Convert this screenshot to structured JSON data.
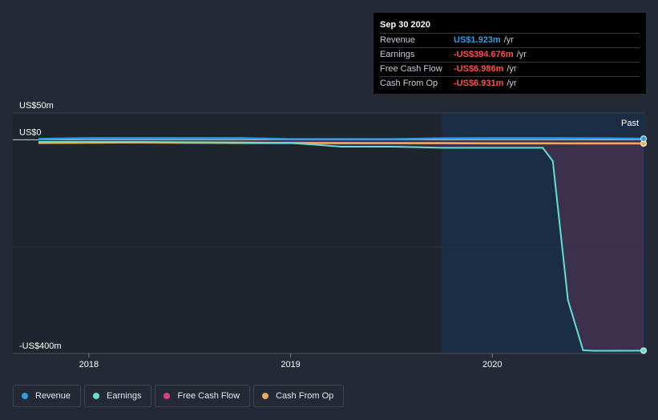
{
  "tooltip": {
    "date": "Sep 30 2020",
    "rows": [
      {
        "label": "Revenue",
        "value": "US$1.923m",
        "unit": "/yr",
        "color": "#2e9ee6"
      },
      {
        "label": "Earnings",
        "value": "-US$394.676m",
        "unit": "/yr",
        "color": "#ff4d4d"
      },
      {
        "label": "Free Cash Flow",
        "value": "-US$6.986m",
        "unit": "/yr",
        "color": "#ff4d4d"
      },
      {
        "label": "Cash From Op",
        "value": "-US$6.931m",
        "unit": "/yr",
        "color": "#ff4d4d"
      }
    ]
  },
  "legend": [
    {
      "label": "Revenue",
      "color": "#2e9ee6"
    },
    {
      "label": "Earnings",
      "color": "#5fe0d0"
    },
    {
      "label": "Free Cash Flow",
      "color": "#d6457a"
    },
    {
      "label": "Cash From Op",
      "color": "#f0aa5a"
    }
  ],
  "chart_data": {
    "type": "line",
    "y_tick_labels": [
      "US$50m",
      "US$0",
      "-US$400m"
    ],
    "y_ticks": [
      50,
      0,
      -400
    ],
    "ylim": [
      -400,
      50
    ],
    "xlim": [
      2017.75,
      2020.75
    ],
    "x_tick_labels": [
      "2018",
      "2019",
      "2020"
    ],
    "x_ticks": [
      2018,
      2019,
      2020
    ],
    "past_label": "Past",
    "past_region_start": 2019.75,
    "grid": "horizontal",
    "series": [
      {
        "name": "Revenue",
        "color": "#2e9ee6",
        "x": [
          2017.75,
          2018.0,
          2018.5,
          2018.75,
          2019.0,
          2019.25,
          2019.5,
          2019.75,
          2020.0,
          2020.25,
          2020.5,
          2020.75
        ],
        "y": [
          1.5,
          3,
          3,
          3,
          1,
          1,
          1,
          2.5,
          3,
          3,
          2.5,
          1.9
        ]
      },
      {
        "name": "Earnings",
        "color": "#5fe0d0",
        "x": [
          2017.75,
          2018.0,
          2018.25,
          2018.5,
          2018.75,
          2019.0,
          2019.15,
          2019.25,
          2019.5,
          2019.75,
          2020.0,
          2020.25,
          2020.3,
          2020.375,
          2020.45,
          2020.5,
          2020.75
        ],
        "y": [
          -4,
          -4,
          -4,
          -4.5,
          -5,
          -6,
          -10,
          -13,
          -13,
          -15,
          -15,
          -15,
          -40,
          -300,
          -394,
          -395,
          -394.7
        ]
      },
      {
        "name": "Free Cash Flow",
        "color": "#d6457a",
        "x": [
          2017.75,
          2018.0,
          2018.5,
          2019.0,
          2019.5,
          2019.75,
          2020.0,
          2020.25,
          2020.5,
          2020.75
        ],
        "y": [
          -5,
          -5,
          -5.5,
          -5.5,
          -6,
          -6,
          -6.5,
          -6.5,
          -7,
          -7
        ]
      },
      {
        "name": "Cash From Op",
        "color": "#f0aa5a",
        "x": [
          2017.75,
          2018.0,
          2018.25,
          2018.5,
          2018.75,
          2019.0,
          2019.25,
          2019.5,
          2019.75,
          2020.0,
          2020.25,
          2020.5,
          2020.75
        ],
        "y": [
          -6,
          -5.5,
          -5,
          -5.5,
          -6,
          -6,
          -6.5,
          -6.5,
          -6.5,
          -6.8,
          -6.8,
          -6.9,
          -6.9
        ]
      }
    ]
  }
}
